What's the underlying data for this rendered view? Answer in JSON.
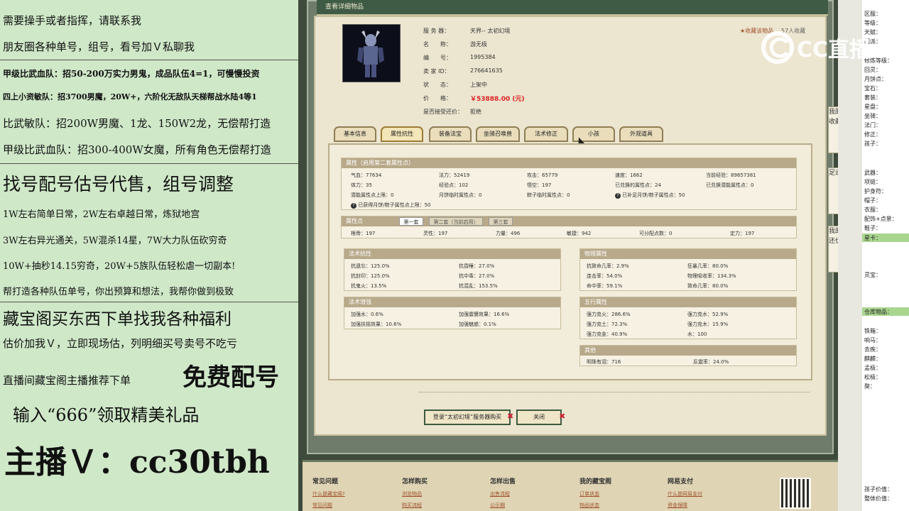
{
  "left_overlay": {
    "lines": [
      "需要操手或者指挥，请联系我",
      "朋友圈各种单号，组号，看号加Ｖ私聊我",
      "甲级比武血队：招50-200万实力男鬼，成品队伍4=1，可慢慢投资",
      "四上小资敏队：招3700男魔，20W+，六阶化无敌队天梯帮战水陆4等1",
      "比武敏队：招200W男魔、1龙、150W2龙，无偿帮打造",
      "甲级比武血队：招300-400W女魔，所有角色无偿帮打造",
      "找号配号估号代售，组号调整",
      "1W左右简单日常，2W左右卓越日常，炼狱地宫",
      "3W左右异光通关，5W混杀14星，7W大力队伍砍穷奇",
      "10W+抽秒14.15穷奇，20W+5族队伍轻松虐一切副本!",
      "帮打造各种队伍单号，你出预算和想法，我帮你做到极致",
      "藏宝阁买东西下单找我各种福利",
      "估价加我Ｖ，立即现场估，列明细买号卖号不吃亏",
      "直播间藏宝阁主播推荐下单",
      "免费配号",
      "输入“666”领取精美礼品",
      "主播Ｖ：cc30tbh"
    ]
  },
  "window": {
    "title": "查看详细物品"
  },
  "item": {
    "server_label": "服 务 器：",
    "server": "天界-- 太初幻境",
    "name_label": "名　　称：",
    "name": "游无极",
    "id_label": "编　　号：",
    "id": "1995384",
    "seller_label": "卖 家 ID：",
    "seller": "276641635",
    "status_label": "状　　态：",
    "status": "上架中",
    "price_label": "价　　格：",
    "price": "￥53888.00 (元)",
    "bargain_label": "是否接受还价：",
    "bargain": "拒绝",
    "fav_link": "收藏该物品",
    "fav_count": "57人收藏"
  },
  "tabs": [
    "基本信息",
    "属性抗性",
    "装备法宝",
    "坐骑召唤兽",
    "法术修正",
    "小孩",
    "外观道具"
  ],
  "attrs": {
    "header": "属性（启用第二套属性点）",
    "row1": [
      "气血：77634",
      "法力：52419",
      "攻击：65779",
      "速度：1662",
      "当前经验：89857381"
    ],
    "row2": [
      "体力：35",
      "经验点：102",
      "悟空：197",
      "已兑换的属性点：24",
      "已兑换潜能属性点：0"
    ],
    "row3": [
      "潜能属性点上限：0",
      "月饼临时属性点：0",
      "粽子临时属性点：0",
      "已补足月饼/粽子属性点：50"
    ],
    "row4": "已获得月饼/粽子属性点上限：50"
  },
  "points": {
    "header": "属性点",
    "subtabs": [
      "第一套",
      "第二套（当前启用）",
      "第三套"
    ],
    "values": [
      "根骨：197",
      "灵性：197",
      "力量：496",
      "敏捷：942",
      "可分配点数：0",
      "定力：197"
    ]
  },
  "spell_resist": {
    "header": "法术抗性",
    "values": [
      "抗遗忘：125.0%",
      "抗昏睡：27.0%",
      "抗封印：125.0%",
      "抗中毒：27.0%",
      "抗鬼火：13.5%",
      "抗混乱：153.5%"
    ]
  },
  "spell_boost": {
    "header": "法术增强",
    "values": [
      "加强水：0.6%",
      "加强震慑效果：16.6%",
      "加强扶摇效果：10.6%",
      "加强魅惑：0.1%"
    ]
  },
  "phys": {
    "header": "物理属性",
    "values": [
      "抗致命几率：2.9%",
      "狂暴几率：80.0%",
      "连击率：54.0%",
      "物理吸收率：134.3%",
      "命中率：59.1%",
      "致命几率：80.0%"
    ]
  },
  "wuxing": {
    "header": "五行属性",
    "values": [
      "强力克火：286.6%",
      "强力克水：52.9%",
      "强力克土：72.3%",
      "强力克木：15.9%",
      "强力克金：40.9%",
      "水：100"
    ]
  },
  "other": {
    "header": "其他",
    "values": [
      "明珠有泪：716",
      "反震率：24.0%"
    ]
  },
  "buttons": {
    "login": "登录“太初幻境”服务器购买",
    "close": "关闭"
  },
  "footer": {
    "cols": [
      {
        "title": "常见问题",
        "links": [
          "什么是藏宝阁?",
          "常见问题"
        ]
      },
      {
        "title": "怎样购买",
        "links": [
          "浏览物品",
          "购买流程"
        ]
      },
      {
        "title": "怎样出售",
        "links": [
          "出售流程",
          "公示期"
        ]
      },
      {
        "title": "我的藏宝阁",
        "links": [
          "订单状态",
          "物品状态"
        ]
      },
      {
        "title": "网易支付",
        "links": [
          "什么是网易支付",
          "资金保障"
        ]
      }
    ]
  },
  "watermark": "CC直播",
  "side_tabs": [
    "我的收藏",
    "足迹",
    "我的还价"
  ],
  "right_panel": {
    "labels_top": [
      "区服：",
      "等级：",
      "天赋：",
      "门派：",
      "修炼等级：",
      "回灵：",
      "月饼点：",
      "宝石：",
      "套装：",
      "星盘：",
      "坐骑：",
      "法门：",
      "修正：",
      "孩子："
    ],
    "labels_mid": [
      "武器：",
      "项链：",
      "护身符：",
      "帽子：",
      "衣服：",
      "配饰+点景：",
      "鞋子：",
      "星卡："
    ],
    "label_lingbao": "灵宝：",
    "label_cangku": "仓库物品：",
    "labels_bottom": [
      "铁箱：",
      "响马：",
      "去疾：",
      "麒麟：",
      "孟极：",
      "松极：",
      "獒："
    ],
    "labels_end": [
      "孩子价值：",
      "整体价值："
    ]
  }
}
